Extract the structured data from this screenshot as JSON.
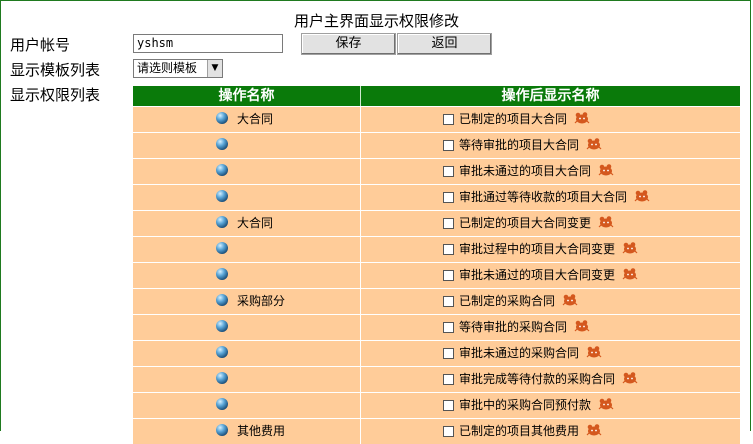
{
  "page": {
    "title": "用户主界面显示权限修改"
  },
  "form": {
    "account_label": "用户帐号",
    "account_value": "yshsm",
    "save_label": "保存",
    "back_label": "返回",
    "template_label": "显示模板列表",
    "template_select": "请选则模板",
    "perm_label": "显示权限列表"
  },
  "table": {
    "headers": [
      "操作名称",
      "操作后显示名称"
    ],
    "rows": [
      {
        "category": "大合同",
        "option": "已制定的项目大合同"
      },
      {
        "category": "",
        "option": "等待审批的项目大合同"
      },
      {
        "category": "",
        "option": "审批未通过的项目大合同"
      },
      {
        "category": "",
        "option": "审批通过等待收款的项目大合同"
      },
      {
        "category": "大合同",
        "option": "已制定的项目大合同变更"
      },
      {
        "category": "",
        "option": "审批过程中的项目大合同变更"
      },
      {
        "category": "",
        "option": "审批未通过的项目大合同变更"
      },
      {
        "category": "采购部分",
        "option": "已制定的采购合同"
      },
      {
        "category": "",
        "option": "等待审批的采购合同"
      },
      {
        "category": "",
        "option": "审批未通过的采购合同"
      },
      {
        "category": "",
        "option": "审批完成等待付款的采购合同"
      },
      {
        "category": "",
        "option": "审批中的采购合同预付款"
      },
      {
        "category": "其他费用",
        "option": "已制定的项目其他费用"
      }
    ]
  },
  "colors": {
    "header_bg": "#0a7a0a",
    "row_bg": "#ffcc99",
    "icon_bug": "#d4581e"
  },
  "icons": {
    "row_bullet": "blue-ball-icon",
    "row_action": "bug-icon"
  }
}
